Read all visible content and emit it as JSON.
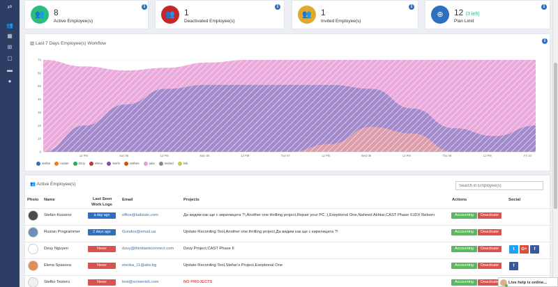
{
  "sidebar": {
    "items": [
      {
        "icon": "transfer-icon",
        "glyph": "⇄"
      },
      {
        "icon": "users-icon",
        "glyph": "👥"
      },
      {
        "icon": "grid-icon",
        "glyph": "▦"
      },
      {
        "icon": "sitemap-icon",
        "glyph": "⊞"
      },
      {
        "icon": "window-icon",
        "glyph": "▢"
      },
      {
        "icon": "card-icon",
        "glyph": "▬"
      },
      {
        "icon": "info-icon",
        "glyph": "●"
      }
    ]
  },
  "stats": [
    {
      "value": "8",
      "extra": "",
      "label": "Active Employee(s)",
      "color": "#2bbd7e",
      "icon": "users-icon"
    },
    {
      "value": "1",
      "extra": "",
      "label": "Deactivated Employee(s)",
      "color": "#c62828",
      "icon": "users-icon"
    },
    {
      "value": "1",
      "extra": "",
      "label": "Invited Employee(s)",
      "color": "#e0a82e",
      "icon": "users-icon"
    },
    {
      "value": "12",
      "extra": "(3 left)",
      "label": "Plan Limit",
      "color": "#2e6fc0",
      "icon": "lifebuoy-icon"
    }
  ],
  "workflow": {
    "title": "Last 7 Days Employee(s) Workflow"
  },
  "chart_data": {
    "type": "area",
    "title": "Last 7 Days Employee(s) Workflow",
    "ylim": [
      0,
      70
    ],
    "yticks": [
      "0",
      "10",
      "20",
      "30",
      "40",
      "50",
      "60",
      "70"
    ],
    "xticks": [
      "12 PM",
      "Sun 05",
      "12 PM",
      "Mon 06",
      "12 PM",
      "Tue 07",
      "12 PM",
      "Wed 08",
      "12 PM",
      "Thu 09",
      "12 PM",
      "Fri 10"
    ],
    "series": [
      {
        "name": "julia",
        "color": "#e89bd6",
        "values": [
          70,
          65,
          62,
          64,
          68,
          70,
          70,
          70,
          70,
          70,
          70,
          70,
          70
        ]
      },
      {
        "name": "sterlo",
        "color": "#9585c9",
        "values": [
          0,
          20,
          36,
          48,
          51,
          51,
          51,
          51,
          48,
          33,
          18,
          12,
          20
        ]
      },
      {
        "name": "elena",
        "color": "#e6a0a6",
        "values": [
          0,
          0,
          0,
          0,
          0,
          0,
          0,
          6,
          19,
          14,
          0,
          0,
          0
        ]
      }
    ],
    "legend": [
      "stefan",
      "ruslan",
      "dzuy",
      "elena",
      "sterlo",
      "anthes",
      "julia",
      "invited",
      "link"
    ],
    "legend_colors": [
      "#2e6fc0",
      "#e67e22",
      "#27ae60",
      "#c0392b",
      "#8e44ad",
      "#d35400",
      "#e89bd6",
      "#7f8c8d",
      "#c9c94a"
    ],
    "legend_placement": "bottom-left",
    "grid": true
  },
  "active": {
    "title": "Active Employee(s)",
    "search_placeholder": "Search in Employee(s)",
    "headers": {
      "photo": "Photo",
      "name": "Name",
      "last_seen_1": "Last Seen",
      "last_seen_2": "Work Logs",
      "email": "Email",
      "projects": "Projects",
      "actions": "Actions",
      "social": "Social"
    },
    "accounting_label": "Accounting",
    "deactivate_label": "Deactivate",
    "rows": [
      {
        "name": "Stefan Kozarov",
        "seen": "a day ago",
        "seen_color": "blue",
        "email": "office@ludizain.com",
        "projects": "Да видим как ще с кирилицата ?!,Another one thrilling project,Repair your PC :),Exeptional One,Naheed Akhtar,CAST Phase II,IDX Reborn",
        "social": []
      },
      {
        "name": "Ruslan Programmer",
        "seen": "2 days ago",
        "seen_color": "blue",
        "email": "Gundos@email.ua",
        "projects": "Update Recording Tool,Another one thrilling project,Да видим как ще с кирилицата ?!",
        "social": []
      },
      {
        "name": "Dzuy Nguyen",
        "seen": "Never",
        "seen_color": "red",
        "email": "dzuy@thinktankconnect.com",
        "projects": "Dzuy Project,CAST Phase II",
        "social": [
          "t",
          "G+",
          "f"
        ]
      },
      {
        "name": "Elena Spasova",
        "seen": "Never",
        "seen_color": "red",
        "email": "elenka_11@abv.bg",
        "projects": "Update Recording Tool,Stefan's Project,Exeptional One",
        "social": [
          "f"
        ]
      },
      {
        "name": "Stefko Testeru",
        "seen": "Never",
        "seen_color": "red",
        "email": "test@screenish.com",
        "projects": "NO PROJECTS",
        "social": []
      }
    ]
  },
  "live_help": {
    "label": "Live help is online..."
  }
}
